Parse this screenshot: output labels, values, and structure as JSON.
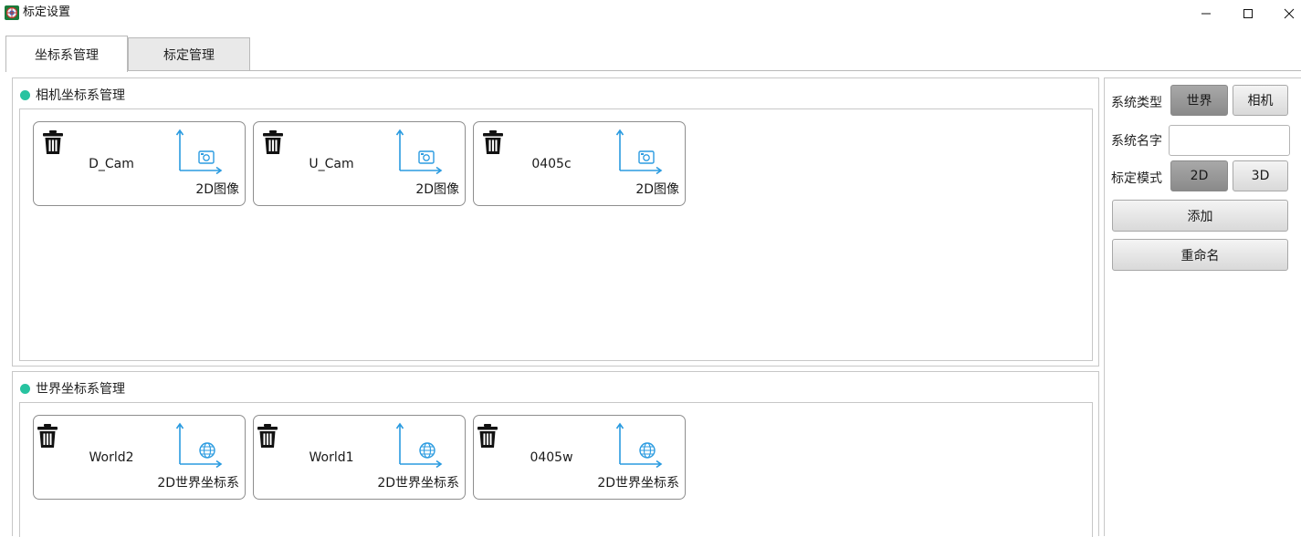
{
  "window": {
    "title": "标定设置"
  },
  "tabs": [
    {
      "label": "坐标系管理",
      "active": true
    },
    {
      "label": "标定管理",
      "active": false
    }
  ],
  "camera_group": {
    "title": "相机坐标系管理",
    "cards": [
      {
        "name": "D_Cam",
        "type": "2D图像",
        "icon": "camera-icon"
      },
      {
        "name": "U_Cam",
        "type": "2D图像",
        "icon": "camera-icon"
      },
      {
        "name": "0405c",
        "type": "2D图像",
        "icon": "camera-icon"
      }
    ]
  },
  "world_group": {
    "title": "世界坐标系管理",
    "cards": [
      {
        "name": "World2",
        "type": "2D世界坐标系",
        "icon": "globe-icon"
      },
      {
        "name": "World1",
        "type": "2D世界坐标系",
        "icon": "globe-icon"
      },
      {
        "name": "0405w",
        "type": "2D世界坐标系",
        "icon": "globe-icon"
      }
    ]
  },
  "panel": {
    "system_type_label": "系统类型",
    "system_type_options": [
      "世界",
      "相机"
    ],
    "system_type_selected": "世界",
    "system_name_label": "系统名字",
    "system_name_value": "",
    "calib_mode_label": "标定模式",
    "calib_mode_options": [
      "2D",
      "3D"
    ],
    "calib_mode_selected": "2D",
    "add_label": "添加",
    "rename_label": "重命名"
  },
  "colors": {
    "accent_dot": "#27c3a0",
    "axis_blue": "#2a9be0",
    "selected_button": "#999999"
  }
}
